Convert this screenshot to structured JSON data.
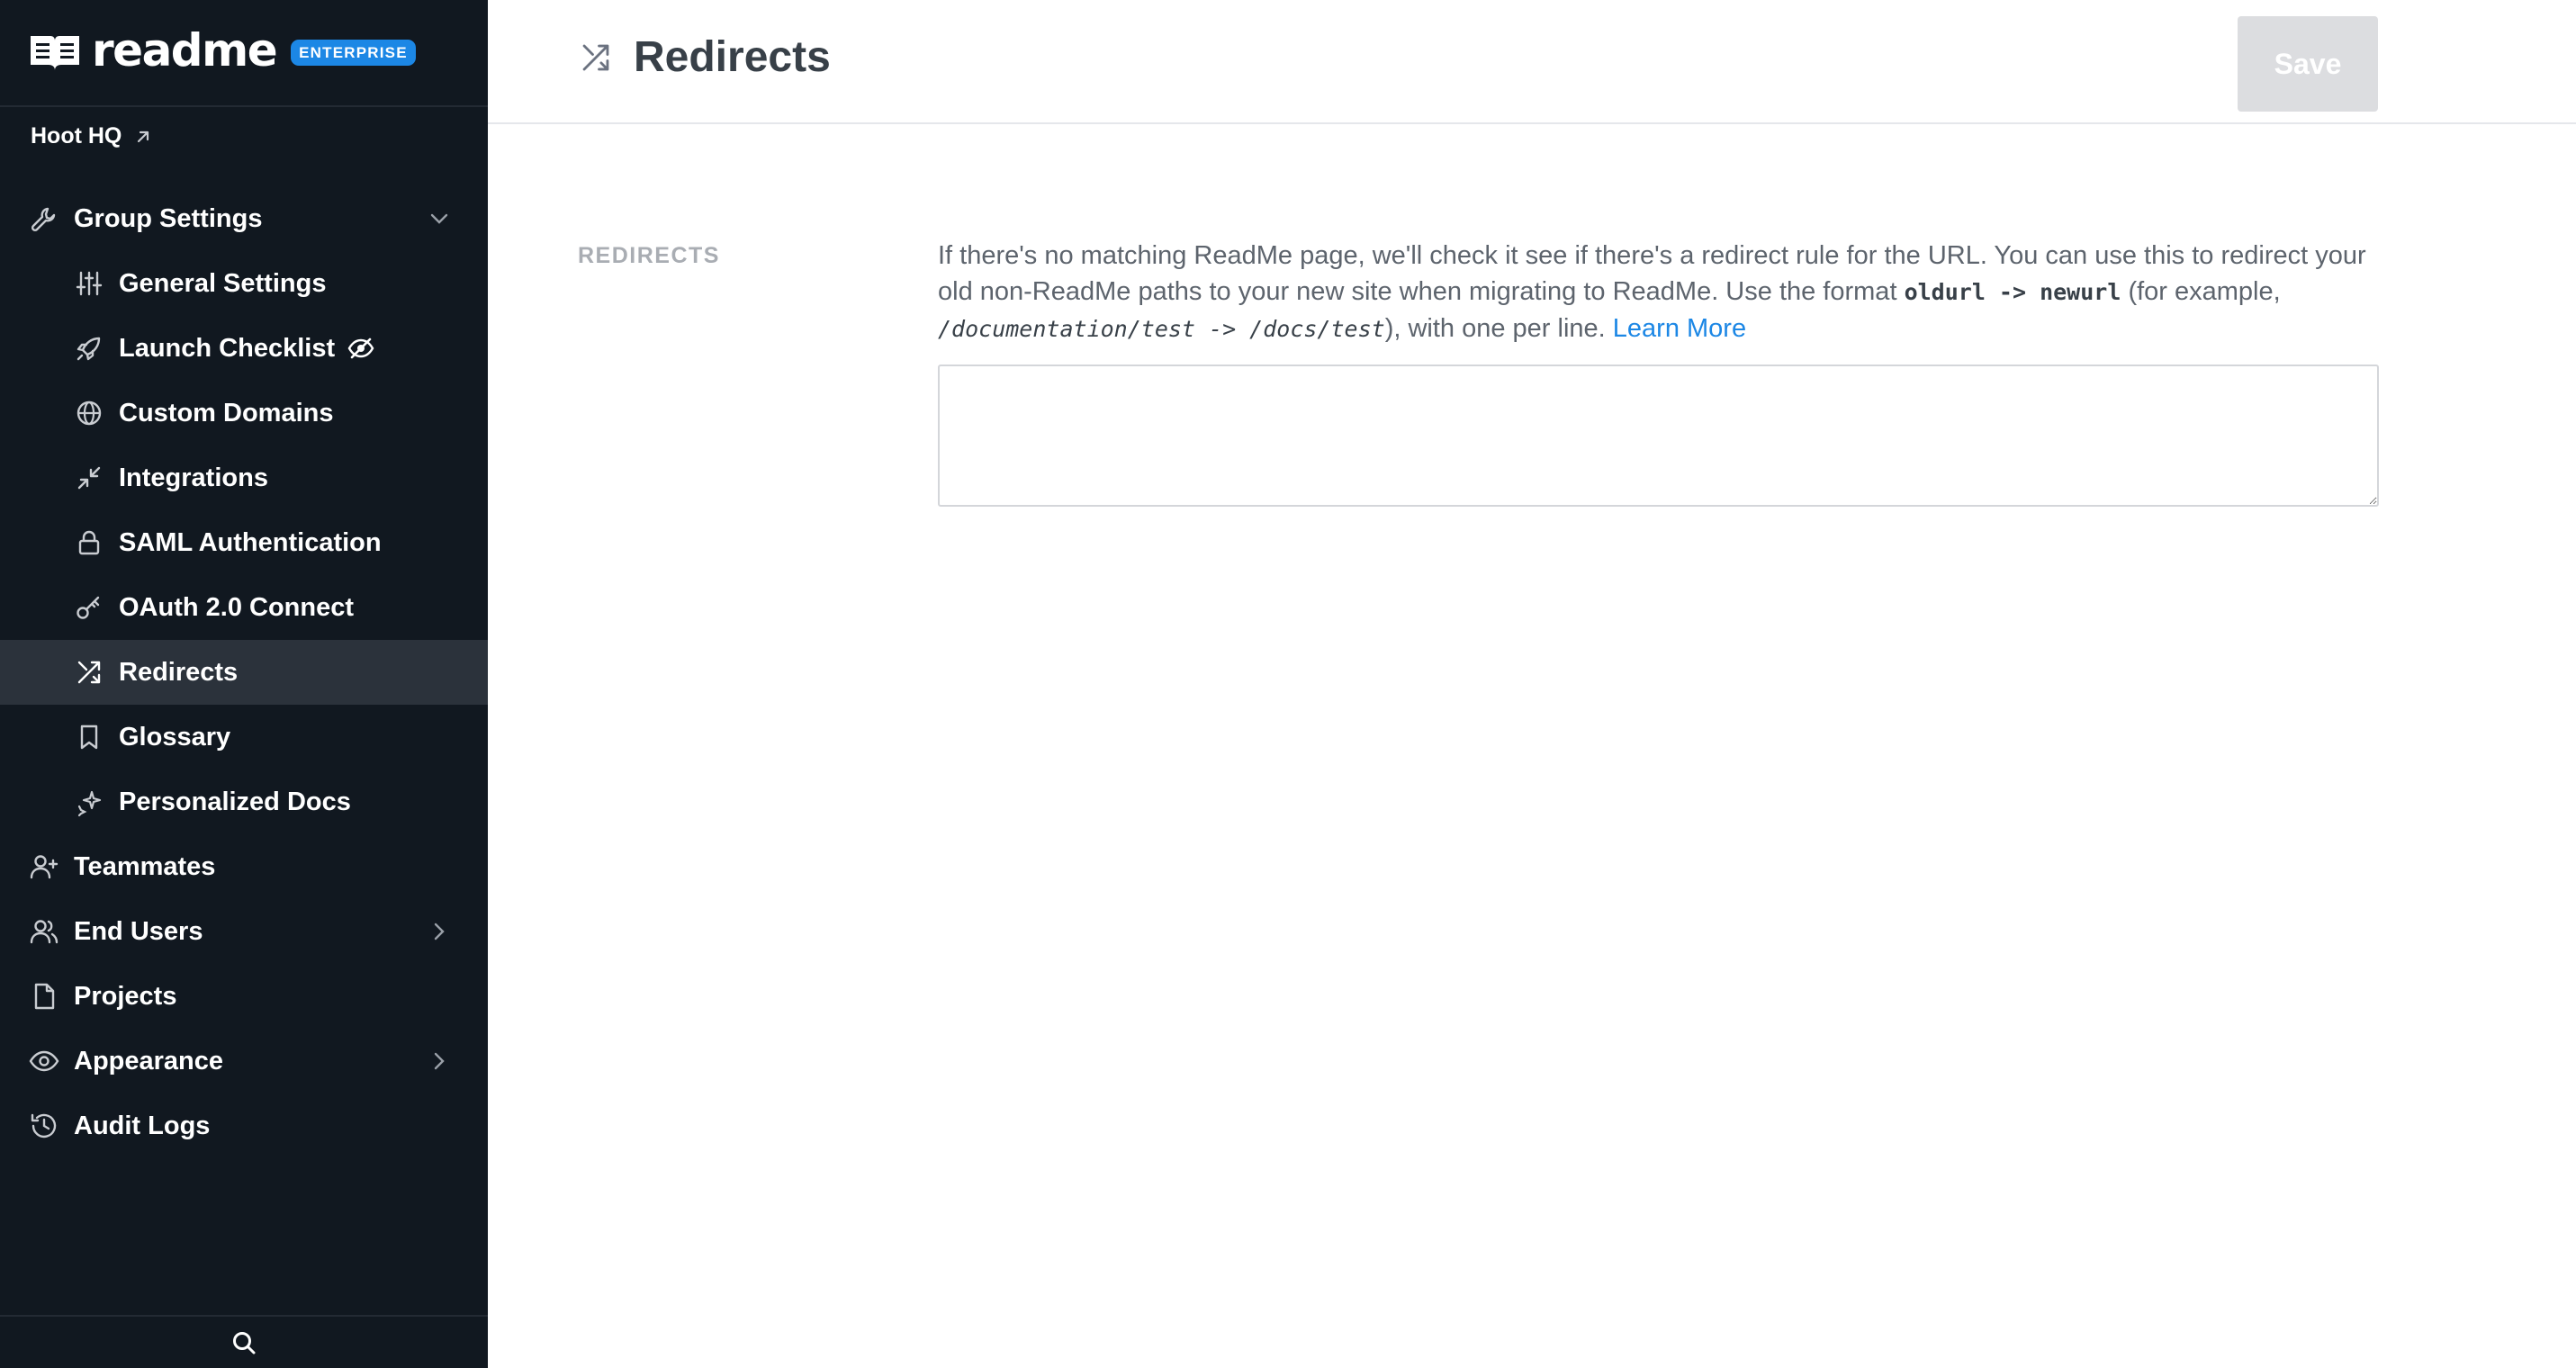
{
  "brand": {
    "name": "readme",
    "badge": "ENTERPRISE"
  },
  "project": {
    "name": "Hoot HQ"
  },
  "sidebar": {
    "items": [
      {
        "label": "Group Settings",
        "icon": "wrench-icon"
      },
      {
        "label": "General Settings",
        "icon": "sliders-icon"
      },
      {
        "label": "Launch Checklist",
        "icon": "rocket-icon"
      },
      {
        "label": "Custom Domains",
        "icon": "globe-icon"
      },
      {
        "label": "Integrations",
        "icon": "minimize-arrows-icon"
      },
      {
        "label": "SAML Authentication",
        "icon": "lock-icon"
      },
      {
        "label": "OAuth 2.0 Connect",
        "icon": "key-icon"
      },
      {
        "label": "Redirects",
        "icon": "shuffle-icon"
      },
      {
        "label": "Glossary",
        "icon": "bookmark-icon"
      },
      {
        "label": "Personalized Docs",
        "icon": "sparkle-icon"
      },
      {
        "label": "Teammates",
        "icon": "user-plus-icon"
      },
      {
        "label": "End Users",
        "icon": "users-icon"
      },
      {
        "label": "Projects",
        "icon": "file-icon"
      },
      {
        "label": "Appearance",
        "icon": "eye-icon"
      },
      {
        "label": "Audit Logs",
        "icon": "history-icon"
      }
    ],
    "active": "Redirects"
  },
  "header": {
    "title": "Redirects",
    "save_label": "Save"
  },
  "section": {
    "label": "REDIRECTS",
    "description_part1": "If there's no matching ReadMe page, we'll check it see if there's a redirect rule for the URL. You can use this to redirect your old non-ReadMe paths to your new site when migrating to ReadMe. Use the format ",
    "format_code": "oldurl -> newurl",
    "description_part2": " (for example, ",
    "example_code": "/documentation/test -> /docs/test",
    "description_part3": "), with one per line. ",
    "learn_more": "Learn More",
    "textarea_value": ""
  },
  "colors": {
    "sidebar_bg": "#111820",
    "active_item_bg": "#2b323b",
    "accent": "#1c87e5",
    "save_disabled": "#dcdde0"
  }
}
